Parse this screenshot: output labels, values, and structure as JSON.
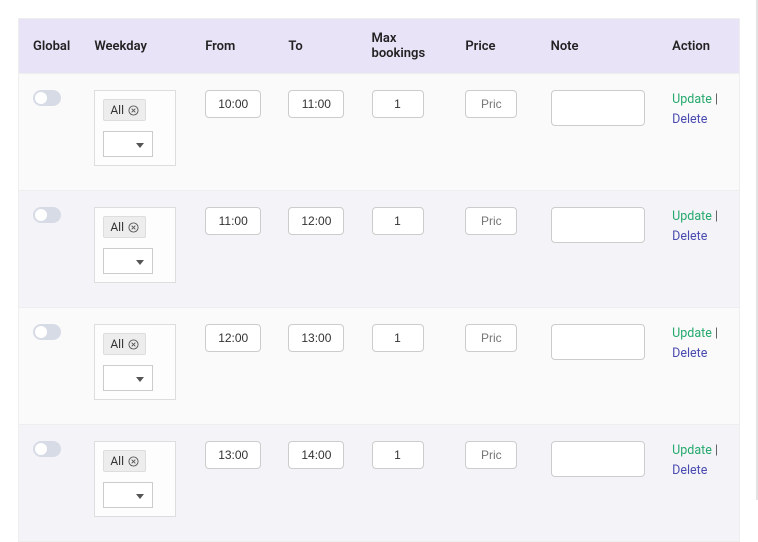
{
  "headers": {
    "global": "Global",
    "weekday": "Weekday",
    "from": "From",
    "to": "To",
    "max": "Max bookings",
    "price": "Price",
    "note": "Note",
    "action": "Action"
  },
  "chip_label": "All",
  "price_placeholder": "Pric",
  "actions": {
    "update": "Update",
    "delete": "Delete"
  },
  "rows": [
    {
      "from": "10:00",
      "to": "11:00",
      "max": "1"
    },
    {
      "from": "11:00",
      "to": "12:00",
      "max": "1"
    },
    {
      "from": "12:00",
      "to": "13:00",
      "max": "1"
    },
    {
      "from": "13:00",
      "to": "14:00",
      "max": "1"
    }
  ]
}
